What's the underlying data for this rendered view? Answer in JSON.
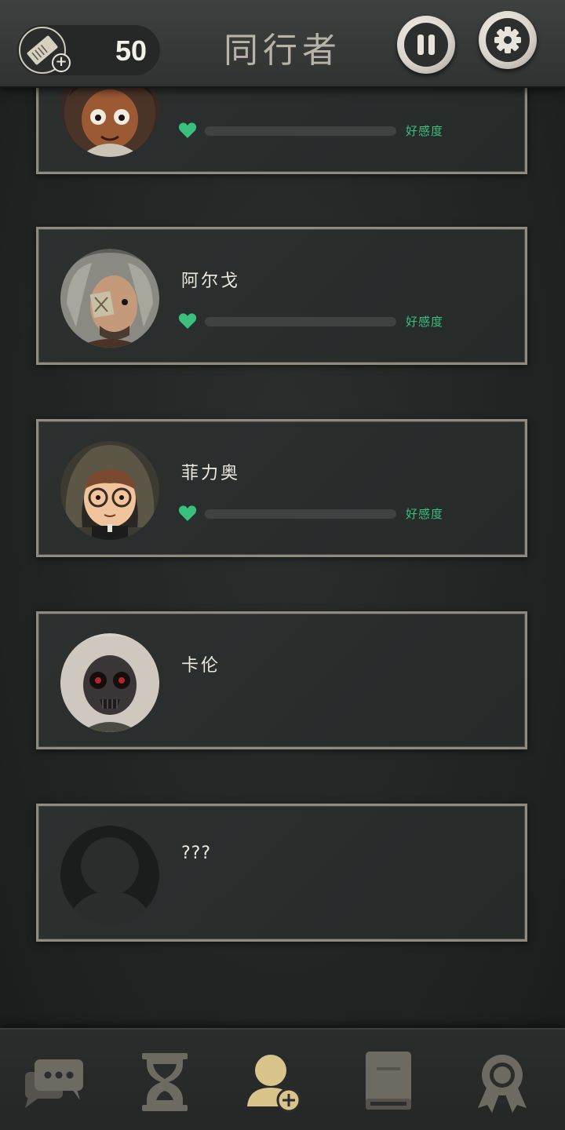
{
  "header": {
    "title": "同行者",
    "tickets": "50",
    "ticket_icon": "ticket-add-icon",
    "pause_icon": "pause-icon",
    "settings_icon": "gear-icon"
  },
  "companions": [
    {
      "name": "",
      "affection_label": "好感度",
      "affection": 0,
      "show_affection": true,
      "avatar": "curly-hair-boy"
    },
    {
      "name": "阿尔戈",
      "affection_label": "好感度",
      "affection": 0,
      "show_affection": true,
      "avatar": "grey-hair-eyepatch-man"
    },
    {
      "name": "菲力奥",
      "affection_label": "好感度",
      "affection": 0,
      "show_affection": true,
      "avatar": "hooded-boy-glasses"
    },
    {
      "name": "卡伦",
      "avatar": "masked-white-hair"
    },
    {
      "name": "???",
      "avatar": "locked-silhouette"
    }
  ],
  "colors": {
    "affection": "#3bbf7f",
    "nav_active": "#d9c48c",
    "nav_inactive": "#6d6a62"
  },
  "nav": [
    {
      "icon": "chat-icon",
      "active": false
    },
    {
      "icon": "hourglass-icon",
      "active": false
    },
    {
      "icon": "companion-add-icon",
      "active": true
    },
    {
      "icon": "book-icon",
      "active": false
    },
    {
      "icon": "achievement-ribbon-icon",
      "active": false
    }
  ]
}
